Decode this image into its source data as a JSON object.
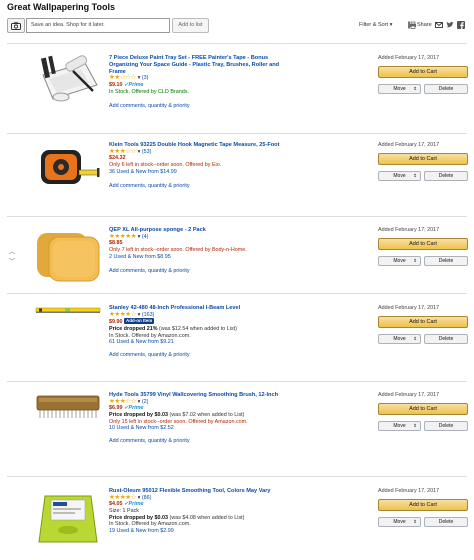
{
  "page": {
    "title": "Great Wallpapering Tools"
  },
  "toolbar": {
    "idea_placeholder": "Save an idea. Shop for it later.",
    "add_to_list_label": "Add to list",
    "filter_sort_label": "Filter & Sort",
    "share_label": "Share",
    "icons": [
      "camera-icon",
      "info-icon",
      "print-icon",
      "envelope-icon",
      "twitter-icon",
      "facebook-icon"
    ]
  },
  "labels": {
    "add_to_cart": "Add to Cart",
    "move": "Move",
    "delete": "Delete",
    "comments_link": "Add comments, quantity & priority",
    "add_on_item": "Add-on Item"
  },
  "colors": {
    "link": "#0a4ca8",
    "price": "#b12704",
    "stock": "#007600",
    "cart_button": "#f0c14b",
    "stars": "#f0a30a"
  },
  "items": [
    {
      "title": "7 Piece Deluxe Paint Tray Set - FREE Painter's Tape - Bonus Organizing Your Space Guide - Plastic Tray, Brushes, Roller and Frame",
      "stars": "★★☆☆☆",
      "rating_count": "(3)",
      "price": "$9.10",
      "prime": "✓Prime",
      "lines": [
        "In Stock. Offered by CLD Brands."
      ],
      "added": "Added February 17, 2017"
    },
    {
      "title": "Klein Tools 93225 Double Hook Magnetic Tape Measure, 25-Foot",
      "stars": "★★★☆☆",
      "rating_count": "(53)",
      "price": "$24.32",
      "warn": "Only 6 left in stock--order soon. Offered by Eio.",
      "used_new": "36 Used & New from $14.99",
      "added": "Added February 17, 2017"
    },
    {
      "title": "QEP XL All-purpose sponge - 2 Pack",
      "stars": "★★★★★",
      "rating_count": "(4)",
      "price": "$8.85",
      "warn": "Only 7 left in stock--order soon. Offered by Body-n-Home.",
      "used_new": "2 Used & New from $8.95",
      "added": "Added February 17, 2017"
    },
    {
      "title": "Stanley 42-480 48-Inch Professional I-Beam Level",
      "stars": "★★★★☆",
      "rating_count": "(163)",
      "price": "$9.90",
      "price_drop": "Price dropped 21%",
      "price_drop_note": "(was $12.54 when added to List)",
      "stock": "In Stock. Offered by Amazon.com.",
      "used_new": "61 Used & New from $9.21",
      "added": "Added February 17, 2017"
    },
    {
      "title": "Hyde Tools 35799 Vinyl Wallcovering Smoothing Brush, 12-Inch",
      "stars": "★★★☆☆",
      "rating_count": "(2)",
      "price": "$6.99",
      "prime": "✓Prime",
      "price_drop": "Price dropped by $0.03",
      "price_drop_note": "(was $7.02 when added to List)",
      "warn": "Only 15 left in stock--order soon. Offered by Amazon.com.",
      "used_new": "10 Used & New from $2.52",
      "added": "Added February 17, 2017"
    },
    {
      "title": "Rust-Oleum 95012 Flexible Smoothing Tool, Colors May Vary",
      "stars": "★★★★☆",
      "rating_count": "(86)",
      "price": "$4.05",
      "prime": "✓Prime",
      "size": "Size: 1 Pack",
      "price_drop": "Price dropped by $0.03",
      "price_drop_note": "(was $4.08 when added to List)",
      "stock": "In Stock. Offered by Amazon.com.",
      "used_new": "19 Used & New from $2.99",
      "added": "Added February 17, 2017"
    }
  ]
}
